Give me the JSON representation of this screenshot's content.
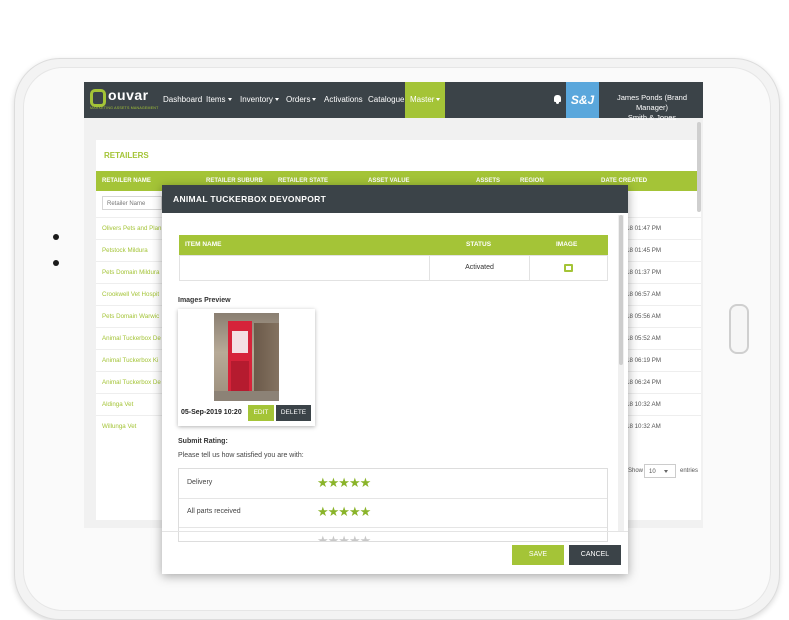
{
  "app": {
    "logo_text": "ouvar",
    "logo_tagline": "MARKETING ASSETS MANAGEMENT",
    "nav": [
      "Dashboard",
      "Items",
      "Inventory",
      "Orders",
      "Activations",
      "Catalogue",
      "Master"
    ],
    "client_logo": "S&J",
    "user_name": "James Ponds (Brand Manager)",
    "user_company": "Smith & Jones"
  },
  "retailers": {
    "title": "RETAILERS",
    "columns": [
      "RETAILER NAME",
      "RETAILER SUBURB",
      "RETAILER STATE",
      "ASSET VALUE",
      "ASSETS",
      "REGION",
      "DATE CREATED"
    ],
    "filter_placeholder": "Retailer Name",
    "rows": [
      {
        "name": "Olivers Pets and Plan",
        "date": "18 01:47 PM"
      },
      {
        "name": "Petstock Mildura",
        "date": "18 01:45 PM"
      },
      {
        "name": "Pets Domain Mildura",
        "date": "18 01:37 PM"
      },
      {
        "name": "Crookwell Vet Hospit",
        "date": "18 06:57 AM"
      },
      {
        "name": "Pets Domain Warwic",
        "date": "18 05:56 AM"
      },
      {
        "name": "Animal Tuckerbox De",
        "date": "18 05:52 AM"
      },
      {
        "name": "Animal Tuckerbox Ki",
        "date": "18 06:19 PM"
      },
      {
        "name": "Animal Tuckerbox De",
        "date": "18 06:24 PM"
      },
      {
        "name": "Aldinga Vet",
        "date": "18 10:32 AM"
      },
      {
        "name": "Willunga Vet",
        "date": "18 10:32 AM"
      }
    ],
    "show_label": "Show",
    "page_size": "10",
    "entries_label": "entries"
  },
  "modal": {
    "title": "ANIMAL TUCKERBOX DEVONPORT",
    "table_headers": [
      "ITEM NAME",
      "STATUS",
      "IMAGE"
    ],
    "item": {
      "name": "",
      "status": "Activated"
    },
    "images_preview_label": "Images Preview",
    "image_date": "05-Sep-2019 10:20",
    "edit_label": "EDIT",
    "delete_label": "DELETE",
    "rating_title": "Submit Rating:",
    "rating_subtitle": "Please tell us how satisfied you are with:",
    "ratings": [
      {
        "label": "Delivery",
        "stars": 5
      },
      {
        "label": "All parts received",
        "stars": 5
      },
      {
        "label": "",
        "stars": 5
      }
    ],
    "save_label": "SAVE",
    "cancel_label": "CANCEL"
  },
  "colors": {
    "accent": "#a4c437",
    "dark": "#3b4348",
    "client": "#5aa7dc"
  }
}
